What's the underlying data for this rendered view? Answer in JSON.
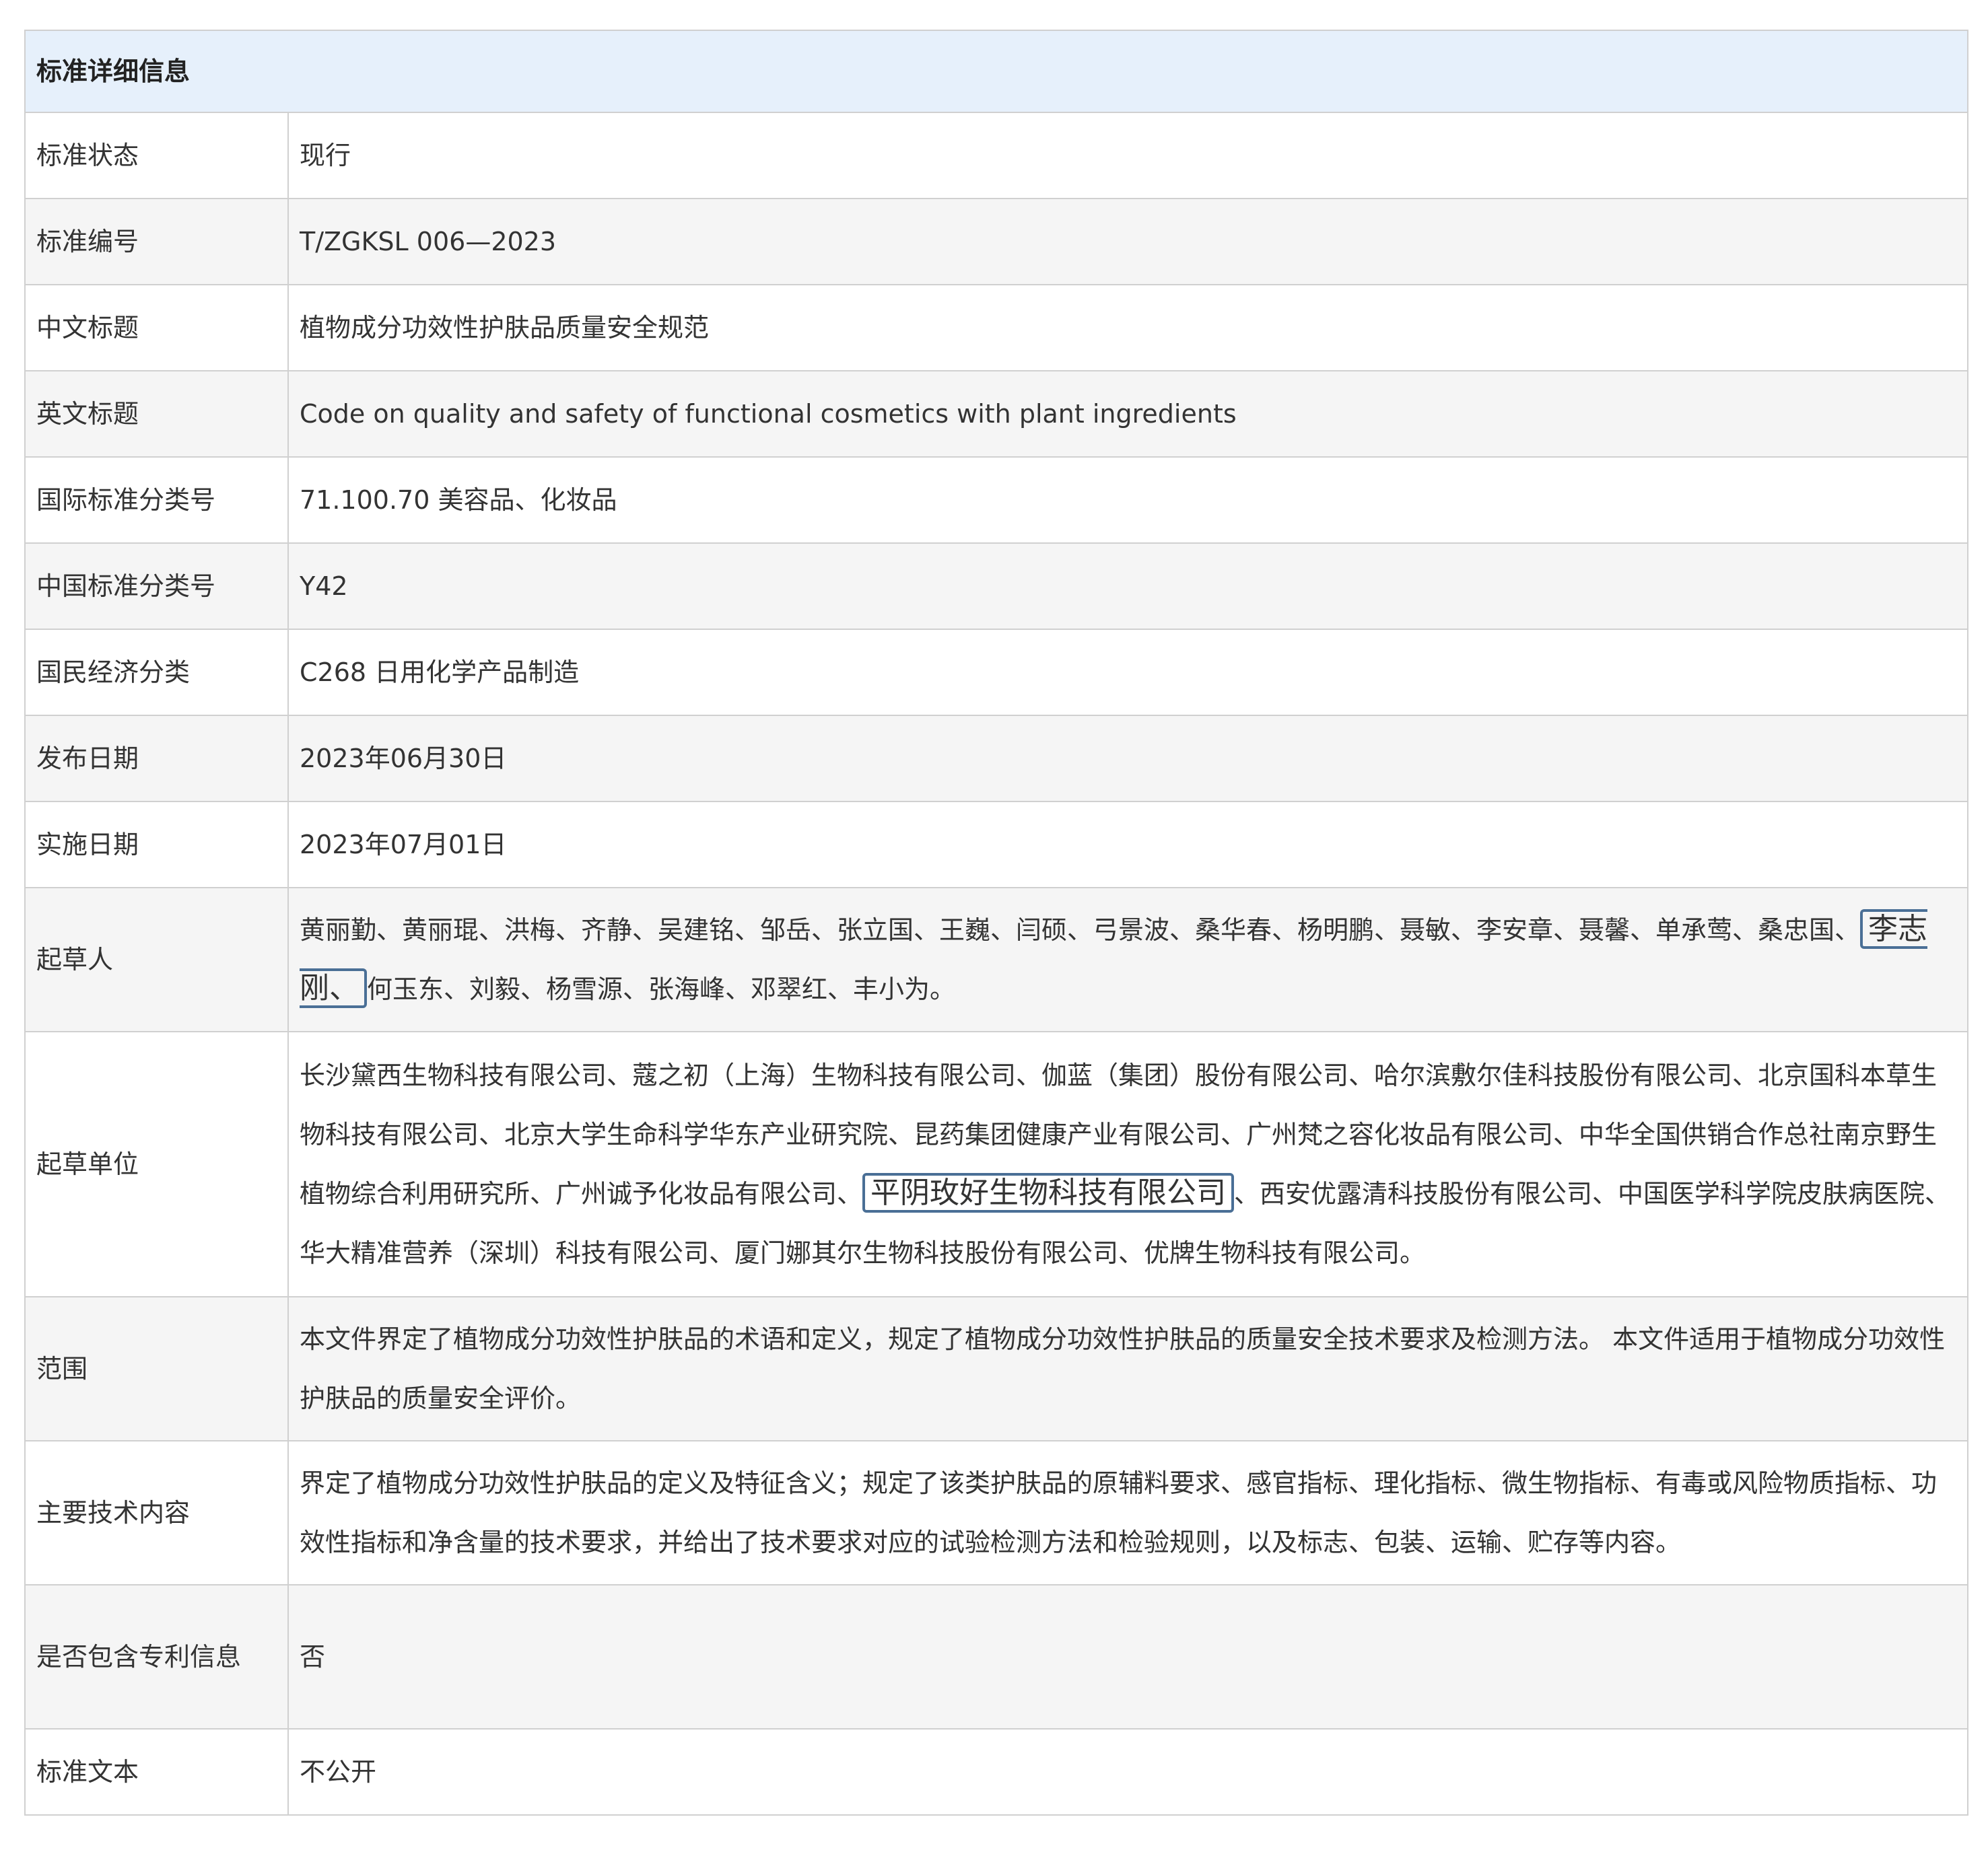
{
  "header": "标准详细信息",
  "rows": [
    {
      "label": "标准状态",
      "value": "现行"
    },
    {
      "label": "标准编号",
      "value": "T/ZGKSL 006—2023"
    },
    {
      "label": "中文标题",
      "value": "植物成分功效性护肤品质量安全规范"
    },
    {
      "label": "英文标题",
      "value": "Code on quality and safety of functional cosmetics with plant ingredients"
    },
    {
      "label": "国际标准分类号",
      "value": "71.100.70 美容品、化妆品"
    },
    {
      "label": "中国标准分类号",
      "value": "Y42"
    },
    {
      "label": "国民经济分类",
      "value": "C268 日用化学产品制造"
    },
    {
      "label": "发布日期",
      "value": "2023年06月30日"
    },
    {
      "label": "实施日期",
      "value": "2023年07月01日"
    }
  ],
  "drafters": {
    "label": "起草人",
    "before": "黄丽勤、黄丽琨、洪梅、齐静、吴建铭、邹岳、张立国、王巍、闫硕、弓景波、桑华春、杨明鹏、聂敏、李安章、聂馨、单承莺、桑忠国、",
    "highlight": "李志刚、",
    "after": "何玉东、刘毅、杨雪源、张海峰、邓翠红、丰小为。"
  },
  "units": {
    "label": "起草单位",
    "before": "长沙黛西生物科技有限公司、蔻之初（上海）生物科技有限公司、伽蓝（集团）股份有限公司、哈尔滨敷尔佳科技股份有限公司、北京国科本草生物科技有限公司、北京大学生命科学华东产业研究院、昆药集团健康产业有限公司、广州梵之容化妆品有限公司、中华全国供销合作总社南京野生植物综合利用研究所、广州诚予化妆品有限公司、",
    "highlight": "平阴玫好生物科技有限公司",
    "after": "、西安优露清科技股份有限公司、中国医学科学院皮肤病医院、华大精准营养（深圳）科技有限公司、厦门娜其尔生物科技股份有限公司、优牌生物科技有限公司。"
  },
  "scope": {
    "label": "范围",
    "value": "本文件界定了植物成分功效性护肤品的术语和定义，规定了植物成分功效性护肤品的质量安全技术要求及检测方法。 本文件适用于植物成分功效性护肤品的质量安全评价。"
  },
  "main_tech": {
    "label": "主要技术内容",
    "value": "界定了植物成分功效性护肤品的定义及特征含义；规定了该类护肤品的原辅料要求、感官指标、理化指标、微生物指标、有毒或风险物质指标、功效性指标和净含量的技术要求，并给出了技术要求对应的试验检测方法和检验规则，以及标志、包装、运输、贮存等内容。"
  },
  "patent": {
    "label": "是否包含专利信息",
    "value": "否"
  },
  "text": {
    "label": "标准文本",
    "value": "不公开"
  }
}
